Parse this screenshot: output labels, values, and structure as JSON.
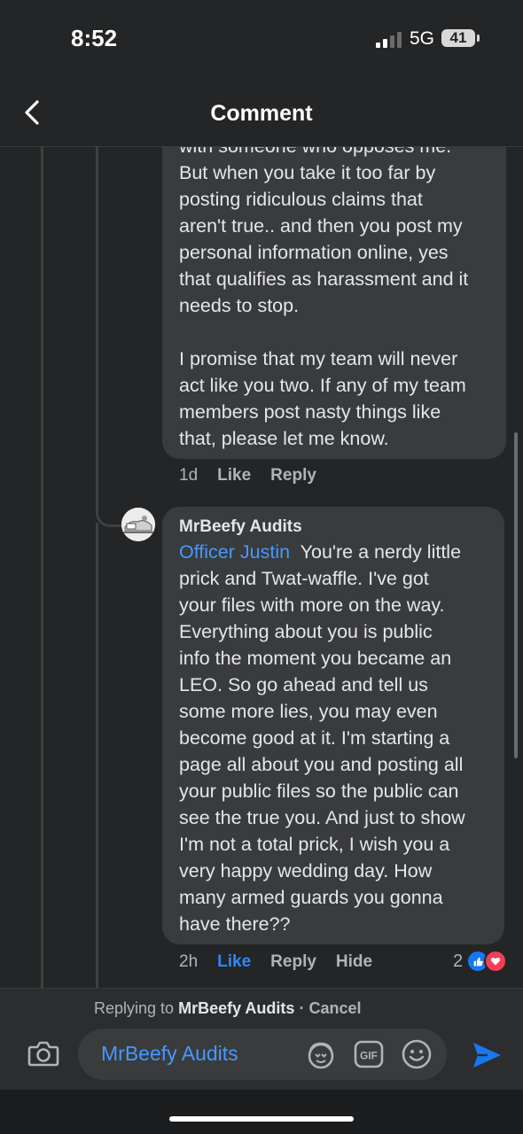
{
  "status": {
    "time": "8:52",
    "network": "5G",
    "battery": "41"
  },
  "header": {
    "title": "Comment"
  },
  "comment1": {
    "lines": [
      "with someone who opposes me.",
      "But when you take it too far by",
      "posting ridiculous claims that",
      "aren't true.. and then you post my",
      "personal information online, yes",
      "that qualifies as harassment and it",
      "needs to stop.",
      "",
      "I promise that my team will never",
      "act like you two. If any of my team",
      "members post nasty things like",
      "that, please let me know."
    ],
    "time": "1d",
    "like": "Like",
    "reply": "Reply"
  },
  "comment2": {
    "author": "MrBeefy Audits",
    "mention": "Officer Justin",
    "first_line_rest": "You're a nerdy little",
    "lines": [
      "prick and Twat-waffle. I've got",
      "your files with more on the way.",
      "Everything about you is public",
      "info the moment you became an",
      "LEO. So go ahead and tell us",
      "some more lies, you may even",
      "become good at it. I'm starting a",
      "page all about you and posting all",
      "your public files so the public can",
      "see the true you. And just to show",
      "I'm not a total prick, I wish you a",
      "very happy wedding day. How",
      "many armed guards you gonna",
      "have there??"
    ],
    "time": "2h",
    "like": "Like",
    "reply": "Reply",
    "hide": "Hide",
    "reaction_count": "2"
  },
  "composer": {
    "replying_prefix": "Replying to",
    "replying_name": "MrBeefy Audits",
    "cancel": "· Cancel",
    "input_value": "MrBeefy Audits"
  },
  "icons": [
    "chevron-left-icon",
    "camera-icon",
    "avatar-sticker-icon",
    "gif-icon",
    "emoji-icon",
    "send-icon",
    "like-reaction-icon",
    "love-reaction-icon"
  ],
  "colors": {
    "accent": "#4599ff",
    "like": "#1877f2",
    "love": "#f33e58",
    "send": "#1877f2"
  }
}
